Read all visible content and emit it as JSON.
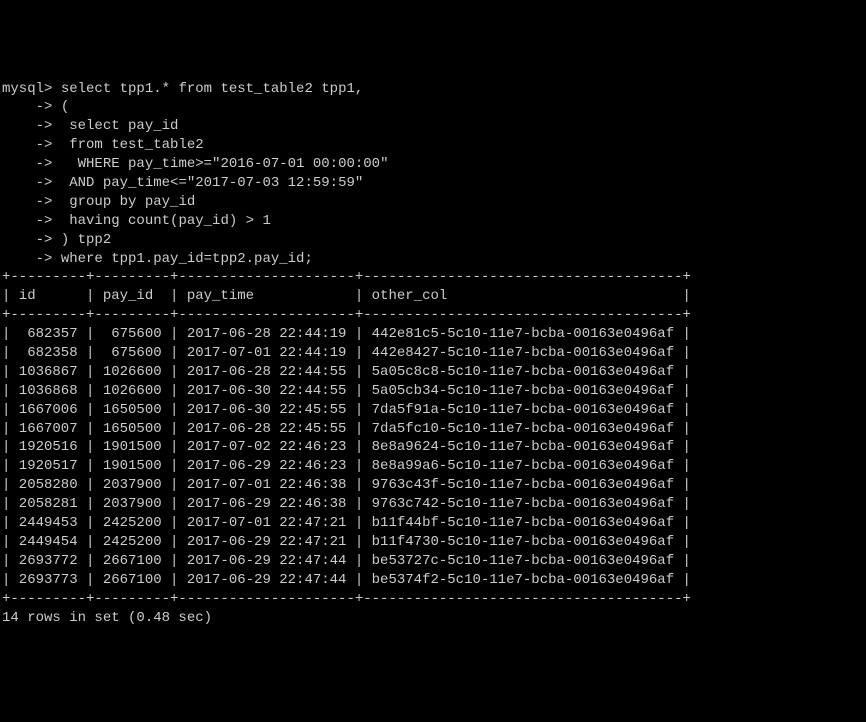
{
  "prompt": "mysql>",
  "continuation": "    ->",
  "query_lines": [
    " select tpp1.* from test_table2 tpp1,",
    " (",
    "  select pay_id",
    "  from test_table2",
    "   WHERE pay_time>=\"2016-07-01 00:00:00\"",
    "  AND pay_time<=\"2017-07-03 12:59:59\"",
    "  group by pay_id",
    "  having count(pay_id) > 1",
    " ) tpp2",
    " where tpp1.pay_id=tpp2.pay_id;"
  ],
  "table": {
    "border": "+---------+---------+---------------------+--------------------------------------+",
    "header": "| id      | pay_id  | pay_time            | other_col                            |",
    "columns": [
      "id",
      "pay_id",
      "pay_time",
      "other_col"
    ],
    "rows": [
      {
        "id": "682357",
        "pay_id": "675600",
        "pay_time": "2017-06-28 22:44:19",
        "other_col": "442e81c5-5c10-11e7-bcba-00163e0496af"
      },
      {
        "id": "682358",
        "pay_id": "675600",
        "pay_time": "2017-07-01 22:44:19",
        "other_col": "442e8427-5c10-11e7-bcba-00163e0496af"
      },
      {
        "id": "1036867",
        "pay_id": "1026600",
        "pay_time": "2017-06-28 22:44:55",
        "other_col": "5a05c8c8-5c10-11e7-bcba-00163e0496af"
      },
      {
        "id": "1036868",
        "pay_id": "1026600",
        "pay_time": "2017-06-30 22:44:55",
        "other_col": "5a05cb34-5c10-11e7-bcba-00163e0496af"
      },
      {
        "id": "1667006",
        "pay_id": "1650500",
        "pay_time": "2017-06-30 22:45:55",
        "other_col": "7da5f91a-5c10-11e7-bcba-00163e0496af"
      },
      {
        "id": "1667007",
        "pay_id": "1650500",
        "pay_time": "2017-06-28 22:45:55",
        "other_col": "7da5fc10-5c10-11e7-bcba-00163e0496af"
      },
      {
        "id": "1920516",
        "pay_id": "1901500",
        "pay_time": "2017-07-02 22:46:23",
        "other_col": "8e8a9624-5c10-11e7-bcba-00163e0496af"
      },
      {
        "id": "1920517",
        "pay_id": "1901500",
        "pay_time": "2017-06-29 22:46:23",
        "other_col": "8e8a99a6-5c10-11e7-bcba-00163e0496af"
      },
      {
        "id": "2058280",
        "pay_id": "2037900",
        "pay_time": "2017-07-01 22:46:38",
        "other_col": "9763c43f-5c10-11e7-bcba-00163e0496af"
      },
      {
        "id": "2058281",
        "pay_id": "2037900",
        "pay_time": "2017-06-29 22:46:38",
        "other_col": "9763c742-5c10-11e7-bcba-00163e0496af"
      },
      {
        "id": "2449453",
        "pay_id": "2425200",
        "pay_time": "2017-07-01 22:47:21",
        "other_col": "b11f44bf-5c10-11e7-bcba-00163e0496af"
      },
      {
        "id": "2449454",
        "pay_id": "2425200",
        "pay_time": "2017-06-29 22:47:21",
        "other_col": "b11f4730-5c10-11e7-bcba-00163e0496af"
      },
      {
        "id": "2693772",
        "pay_id": "2667100",
        "pay_time": "2017-06-29 22:47:44",
        "other_col": "be53727c-5c10-11e7-bcba-00163e0496af"
      },
      {
        "id": "2693773",
        "pay_id": "2667100",
        "pay_time": "2017-06-29 22:47:44",
        "other_col": "be5374f2-5c10-11e7-bcba-00163e0496af"
      }
    ]
  },
  "result_summary": "14 rows in set (0.48 sec)"
}
